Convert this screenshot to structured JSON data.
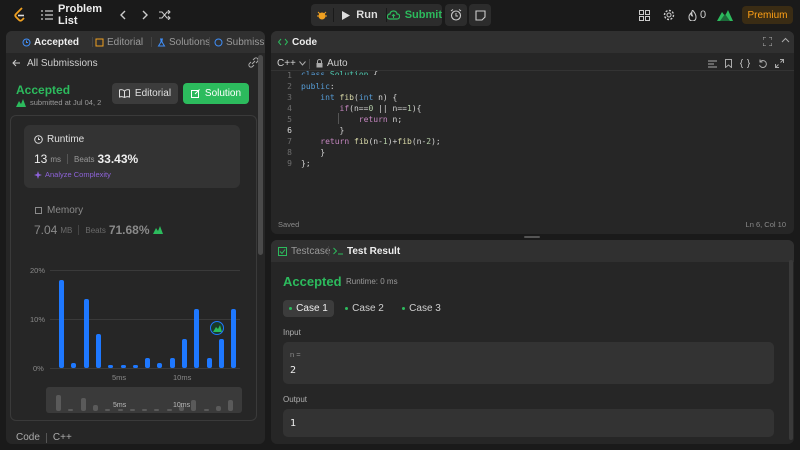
{
  "topbar": {
    "problem_list": "Problem List",
    "run": "Run",
    "submit": "Submit",
    "streak_count": "0",
    "premium": "Premium"
  },
  "left": {
    "tabs": [
      "Accepted",
      "Editorial",
      "Solutions",
      "Submissi"
    ],
    "all_submissions": "All Submissions",
    "status": "Accepted",
    "submitted_at": "submitted at Jul 04, 2",
    "editorial_btn": "Editorial",
    "solution_btn": "Solution",
    "runtime": {
      "label": "Runtime",
      "value": "13",
      "unit": "ms",
      "beats_label": "Beats",
      "beats_value": "33.43%",
      "analyze": "Analyze Complexity"
    },
    "memory": {
      "label": "Memory",
      "value": "7.04",
      "unit": "MB",
      "beats_label": "Beats",
      "beats_value": "71.68%"
    },
    "footer_code": "Code",
    "footer_lang": "C++"
  },
  "chart_data": {
    "type": "bar",
    "ylabel_ticks": [
      "20%",
      "10%",
      "0%"
    ],
    "ylim": [
      0,
      20
    ],
    "x_ticks": [
      "5ms",
      "10ms"
    ],
    "values": [
      18,
      1,
      14,
      7,
      0.5,
      0.5,
      0.5,
      2,
      1,
      2,
      6,
      12,
      2,
      6,
      12
    ],
    "minimap_ticks": [
      "5ms",
      "10ms"
    ],
    "highlight_index": 13
  },
  "code_panel": {
    "title": "Code",
    "language": "C++",
    "auto": "Auto",
    "saved": "Saved",
    "cursor": "Ln 6, Col 10",
    "line_numbers": [
      "1",
      "2",
      "3",
      "4",
      "5",
      "6",
      "7",
      "8",
      "9"
    ]
  },
  "test_panel": {
    "tab_testcase": "Testcase",
    "tab_result": "Test Result",
    "status": "Accepted",
    "runtime": "Runtime: 0 ms",
    "cases": [
      "Case 1",
      "Case 2",
      "Case 3"
    ],
    "input_label": "Input",
    "input_var": "n =",
    "input_value": "2",
    "output_label": "Output",
    "output_value": "1"
  },
  "colors": {
    "accent_green": "#2cbb5d",
    "accent_blue": "#1e78ff",
    "premium": "#ffa116"
  }
}
